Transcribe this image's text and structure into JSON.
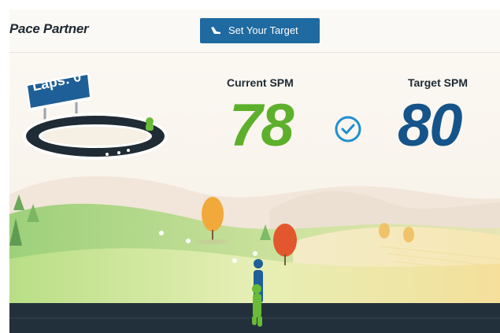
{
  "header": {
    "title": "Pace Partner",
    "set_target_label": "Set Your Target"
  },
  "stats": {
    "current_label": "Current SPM",
    "current_value": "78",
    "target_label": "Target SPM",
    "target_value": "80",
    "on_target": true
  },
  "laps": {
    "label": "Laps: 0",
    "count": 0
  },
  "icons": {
    "button_icon": "shoe-icon",
    "status_icon": "check-circle-icon"
  },
  "colors": {
    "header_button": "#1f6aa1",
    "current_value": "#5db02b",
    "target_value": "#14548a",
    "check": "#1f8fd0",
    "track_ground": "#22303b"
  }
}
